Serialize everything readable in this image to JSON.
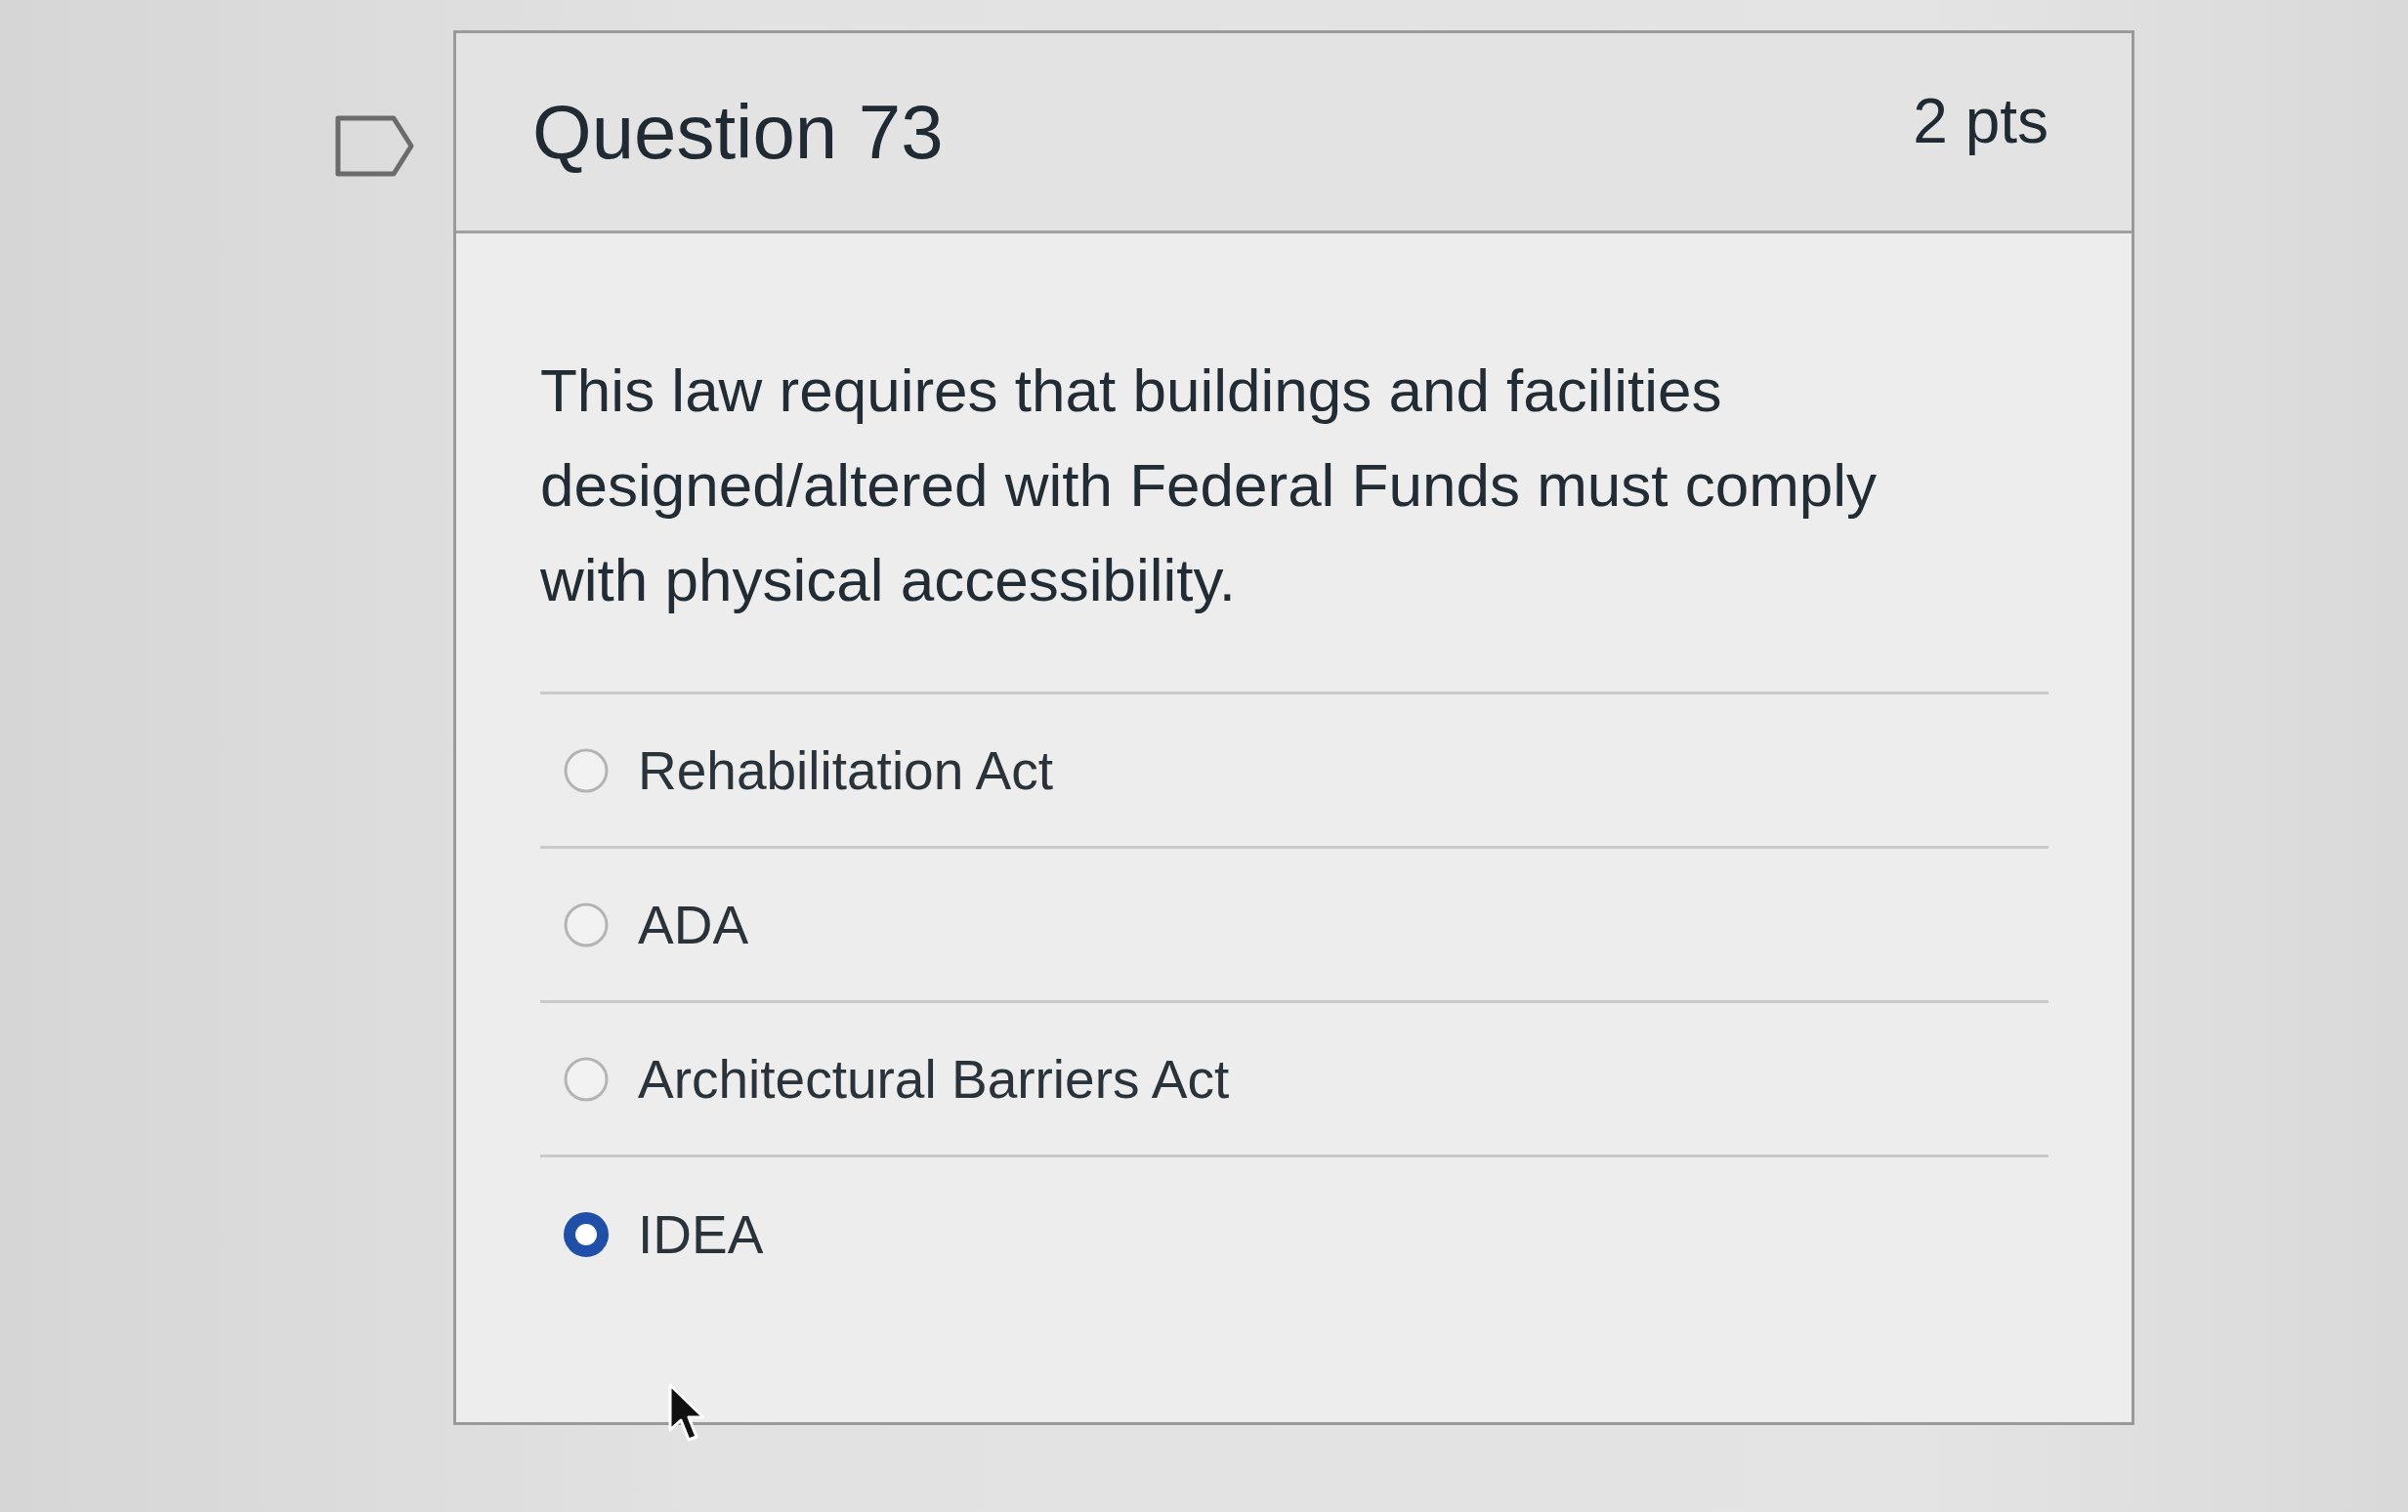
{
  "question": {
    "title": "Question 73",
    "points": "2 pts",
    "text": "This law requires that buildings and facilities designed/altered with Federal Funds must comply with physical accessibility.",
    "answers": [
      {
        "label": "Rehabilitation Act",
        "selected": false
      },
      {
        "label": "ADA",
        "selected": false
      },
      {
        "label": "Architectural Barriers Act",
        "selected": false
      },
      {
        "label": "IDEA",
        "selected": true
      }
    ]
  }
}
